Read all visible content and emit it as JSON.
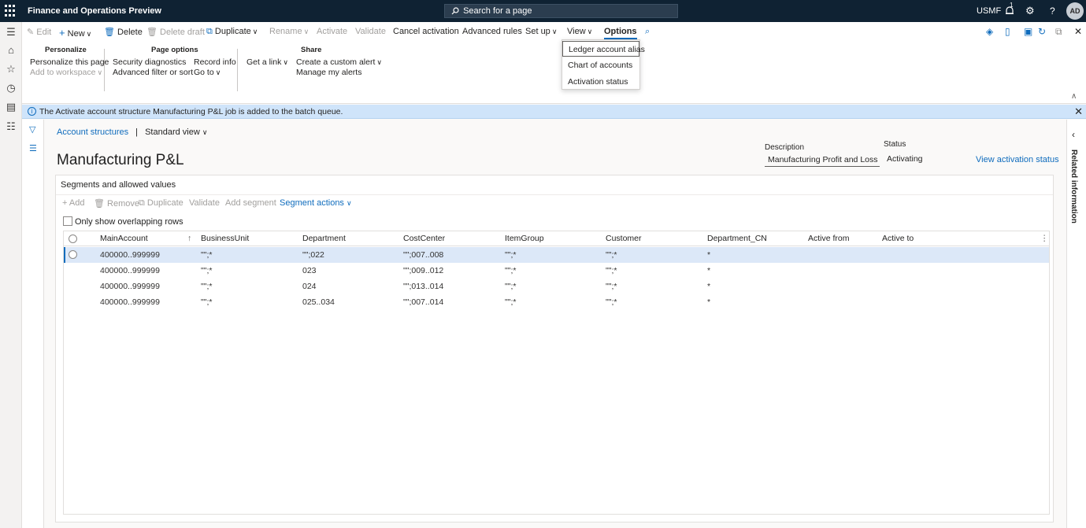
{
  "header": {
    "app_title": "Finance and Operations Preview",
    "search_placeholder": "Search for a page",
    "company": "USMF",
    "notification_count": "1",
    "help_glyph": "?",
    "avatar_initials": "AD"
  },
  "actions": {
    "edit": "Edit",
    "new": "New",
    "delete": "Delete",
    "delete_draft": "Delete draft",
    "duplicate": "Duplicate",
    "rename": "Rename",
    "activate": "Activate",
    "validate": "Validate",
    "cancel_activation": "Cancel activation",
    "advanced_rules": "Advanced rules",
    "set_up": "Set up",
    "view": "View",
    "options": "Options"
  },
  "options_tab": {
    "personalize": {
      "heading": "Personalize",
      "items": [
        "Personalize this page",
        "Add to workspace"
      ]
    },
    "page_options": {
      "heading": "Page options",
      "items": [
        "Security diagnostics",
        "Advanced filter or sort",
        "Record info",
        "Go to"
      ]
    },
    "share": {
      "heading": "Share",
      "items": [
        "Get a link",
        "Create a custom alert",
        "Manage my alerts"
      ]
    }
  },
  "view_dropdown": {
    "items": [
      "Ledger account alias",
      "Chart of accounts",
      "Activation status"
    ]
  },
  "message_bar": {
    "text": "The Activate account structure Manufacturing P&L job is added to the batch queue."
  },
  "breadcrumb": {
    "link": "Account structures",
    "separator": "|",
    "view": "Standard view"
  },
  "page": {
    "title": "Manufacturing P&L",
    "description_label": "Description",
    "description_value": "Manufacturing Profit and Loss",
    "status_label": "Status",
    "status_value": "Activating",
    "view_activation_status": "View activation status"
  },
  "segments": {
    "heading": "Segments and allowed values",
    "toolbar": [
      "Add",
      "Remove",
      "Duplicate",
      "Validate",
      "Add segment",
      "Segment actions"
    ],
    "overlap_checkbox": "Only show overlapping rows",
    "columns": [
      "MainAccount",
      "BusinessUnit",
      "Department",
      "CostCenter",
      "ItemGroup",
      "Customer",
      "Department_CN",
      "Active from",
      "Active to"
    ],
    "rows": [
      [
        "400000..999999",
        "\"\";*",
        "\"\";022",
        "\"\";007..008",
        "\"\";*",
        "\"\";*",
        "*",
        "",
        ""
      ],
      [
        "400000..999999",
        "\"\";*",
        "023",
        "\"\";009..012",
        "\"\";*",
        "\"\";*",
        "*",
        "",
        ""
      ],
      [
        "400000..999999",
        "\"\";*",
        "024",
        "\"\";013..014",
        "\"\";*",
        "\"\";*",
        "*",
        "",
        ""
      ],
      [
        "400000..999999",
        "\"\";*",
        "025..034",
        "\"\";007..014",
        "\"\";*",
        "\"\";*",
        "*",
        "",
        ""
      ]
    ]
  },
  "related_info": {
    "label": "Related information"
  }
}
